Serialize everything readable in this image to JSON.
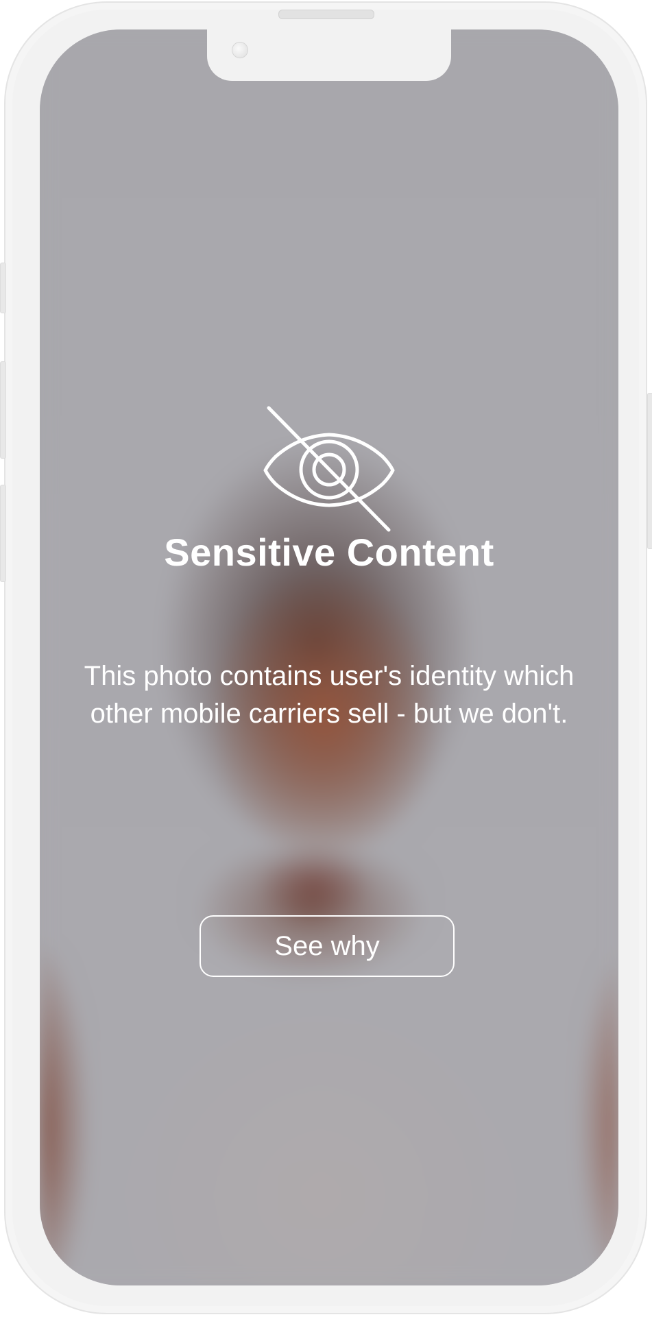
{
  "overlay": {
    "icon": "eye-slash-icon",
    "title": "Sensitive Content",
    "message": "This photo contains user's identity which other mobile carriers sell - but we don't.",
    "button_label": "See why"
  },
  "colors": {
    "text": "#ffffff",
    "frame": "#f2f2f2",
    "button_border": "#ffffff"
  }
}
